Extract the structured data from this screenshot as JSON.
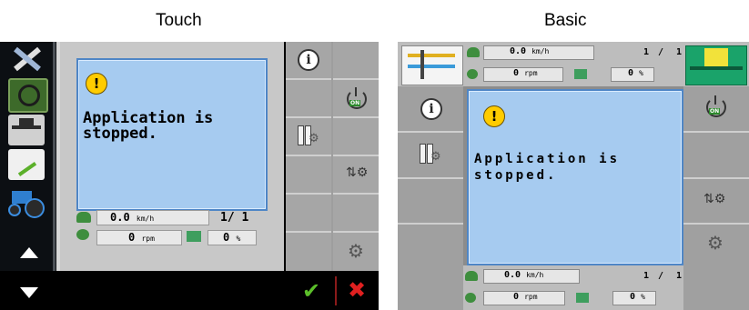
{
  "captions": {
    "touch": "Touch",
    "basic": "Basic"
  },
  "message": {
    "line1": "Application is",
    "line2": "stopped.",
    "warning_symbol": "!"
  },
  "touch": {
    "speed_value": "0.0",
    "speed_unit": "km/h",
    "page": "1/ 1",
    "rpm_value": "0",
    "rpm_unit": "rpm",
    "percent_value": "0",
    "percent_unit": "%",
    "info_symbol": "i",
    "on_tag": "ON",
    "confirm_symbol": "✔",
    "cancel_symbol": "✖"
  },
  "basic": {
    "speed_value": "0.0",
    "speed_unit": "km/h",
    "page_current": "1",
    "page_sep": "/",
    "page_total": "1",
    "rpm_value": "0",
    "rpm_unit": "rpm",
    "percent_value": "0",
    "percent_unit": "%",
    "info_symbol": "i",
    "on_tag": "ON"
  },
  "colors": {
    "message_bg": "#a6cbf0",
    "message_border": "#4f86c6",
    "warning": "#ffcc00",
    "confirm": "#5bbf2a",
    "cancel": "#e02020"
  }
}
